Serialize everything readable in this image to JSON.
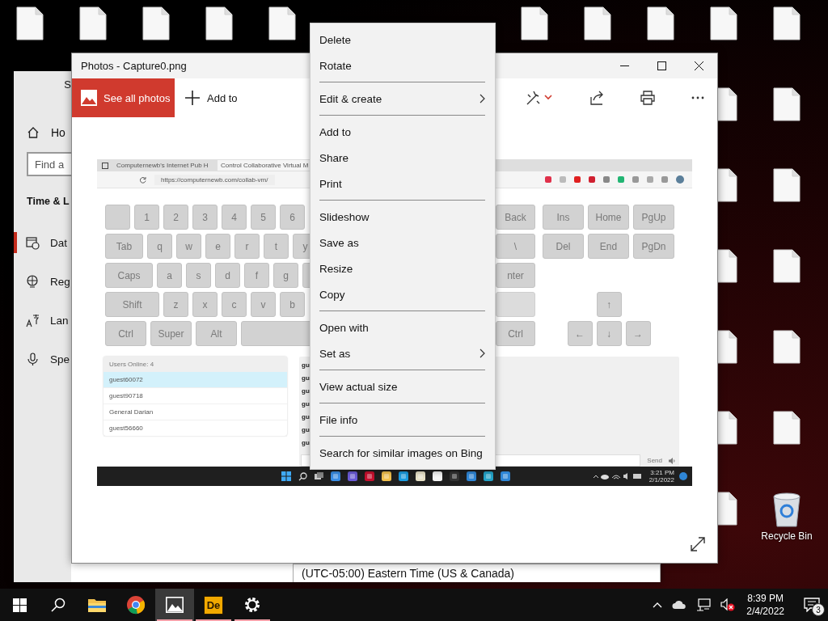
{
  "desktop": {
    "icons": [
      {
        "kind": "file"
      },
      {
        "kind": "file"
      },
      {
        "kind": "file"
      },
      {
        "kind": "file"
      },
      {
        "kind": "file"
      },
      {
        "kind": "file"
      },
      {
        "kind": "file"
      },
      {
        "kind": "file"
      },
      {
        "kind": "file"
      },
      {
        "kind": "file"
      },
      {
        "kind": "file"
      },
      {
        "kind": "file"
      },
      {
        "kind": "file"
      },
      {
        "kind": "file"
      },
      {
        "kind": "file"
      },
      {
        "kind": "file"
      },
      {
        "kind": "file"
      },
      {
        "kind": "file"
      },
      {
        "kind": "file"
      },
      {
        "kind": "file"
      },
      {
        "kind": "file"
      },
      {
        "kind": "recycle-bin",
        "label": "Recycle Bin"
      }
    ]
  },
  "settings_window": {
    "title": "S",
    "home": "Ho",
    "search": {
      "placeholder": "Find a"
    },
    "section": "Time & L",
    "nav": [
      {
        "label": "Dat",
        "kind": "calendar",
        "selected": true
      },
      {
        "label": "Reg",
        "kind": "globe",
        "selected": false
      },
      {
        "label": "Lan",
        "kind": "language",
        "selected": false
      },
      {
        "label": "Spe",
        "kind": "mic",
        "selected": false
      }
    ],
    "timezone": "(UTC-05:00) Eastern Time (US & Canada)"
  },
  "photos_window": {
    "title": "Photos - Capture0.png",
    "see_all": "See all photos",
    "add_to": "Add to"
  },
  "capture": {
    "tabs": [
      {
        "label": "Computernewb's Internet Pub H",
        "selected": false
      },
      {
        "label": "Control Collaborative Virtual M",
        "selected": true
      }
    ],
    "url": "https://computernewb.com/collab-vm/",
    "keys_left": [
      [
        {
          "kind": "blank"
        },
        {
          "kind": "char",
          "label": "1"
        },
        {
          "kind": "char",
          "label": "2"
        },
        {
          "kind": "char",
          "label": "3"
        },
        {
          "kind": "char",
          "label": "4"
        },
        {
          "kind": "char",
          "label": "5"
        },
        {
          "kind": "char",
          "label": "6"
        }
      ],
      [
        {
          "kind": "tab",
          "label": "Tab"
        },
        {
          "kind": "char",
          "label": "q"
        },
        {
          "kind": "char",
          "label": "w"
        },
        {
          "kind": "char",
          "label": "e"
        },
        {
          "kind": "char",
          "label": "r"
        },
        {
          "kind": "char",
          "label": "t"
        },
        {
          "kind": "char",
          "label": "y"
        }
      ],
      [
        {
          "kind": "caps",
          "label": "Caps"
        },
        {
          "kind": "char",
          "label": "a"
        },
        {
          "kind": "char",
          "label": "s"
        },
        {
          "kind": "char",
          "label": "d"
        },
        {
          "kind": "char",
          "label": "f"
        },
        {
          "kind": "char",
          "label": "g"
        },
        {
          "kind": "blank"
        }
      ],
      [
        {
          "kind": "shift",
          "label": "Shift"
        },
        {
          "kind": "char",
          "label": "z"
        },
        {
          "kind": "char",
          "label": "x"
        },
        {
          "kind": "char",
          "label": "c"
        },
        {
          "kind": "char",
          "label": "v"
        },
        {
          "kind": "char",
          "label": "b"
        }
      ],
      [
        {
          "kind": "mod",
          "label": "Ctrl"
        },
        {
          "kind": "mod",
          "label": "Super"
        },
        {
          "kind": "mod",
          "label": "Alt"
        },
        {
          "kind": "space"
        }
      ]
    ],
    "keys_main": [
      {
        "label": "Back"
      },
      {
        "label": "\\"
      },
      {
        "label": "nter"
      },
      {
        "kind": "blank"
      },
      {
        "label": "Ctrl"
      }
    ],
    "keys_nav": [
      [
        {
          "label": "Ins"
        },
        {
          "label": "Home"
        },
        {
          "label": "PgUp"
        }
      ],
      [
        {
          "label": "Del"
        },
        {
          "label": "End"
        },
        {
          "label": "PgDn"
        }
      ]
    ],
    "keys_arrows": [
      [
        {
          "label": "↑"
        }
      ],
      [
        {
          "label": "←"
        },
        {
          "label": "↓"
        },
        {
          "label": "→"
        }
      ]
    ],
    "users": {
      "header": "Users Online: 4",
      "list": [
        {
          "name": "guest60072",
          "selected": true
        },
        {
          "name": "guest90718",
          "selected": false
        },
        {
          "name": "General Darian",
          "selected": false
        },
        {
          "name": "guest56660",
          "selected": false
        }
      ]
    },
    "chat": {
      "lines": [
        "gu",
        "gu",
        "gu",
        "gu",
        "gu",
        "gu",
        "gu"
      ],
      "send": "Send"
    },
    "clock": {
      "time": "3:21 PM",
      "date": "2/1/2022"
    }
  },
  "context_menu": {
    "groups": [
      [
        {
          "label": "Delete",
          "submenu": false
        },
        {
          "label": "Rotate",
          "submenu": false
        }
      ],
      [
        {
          "label": "Edit & create",
          "submenu": true
        }
      ],
      [
        {
          "label": "Add to",
          "submenu": false
        },
        {
          "label": "Share",
          "submenu": false
        },
        {
          "label": "Print",
          "submenu": false
        }
      ],
      [
        {
          "label": "Slideshow",
          "submenu": false
        },
        {
          "label": "Save as",
          "submenu": false
        },
        {
          "label": "Resize",
          "submenu": false
        },
        {
          "label": "Copy",
          "submenu": false
        }
      ],
      [
        {
          "label": "Open with",
          "submenu": false
        },
        {
          "label": "Set as",
          "submenu": true
        }
      ],
      [
        {
          "label": "View actual size",
          "submenu": false
        }
      ],
      [
        {
          "label": "File info",
          "submenu": false
        }
      ],
      [
        {
          "label": "Search for similar images on Bing",
          "submenu": false
        }
      ]
    ]
  },
  "taskbar": {
    "apps": [
      {
        "kind": "explorer",
        "running": false,
        "active": false
      },
      {
        "kind": "chrome",
        "running": false,
        "active": false
      },
      {
        "kind": "photos",
        "running": true,
        "active": true
      },
      {
        "kind": "lettered",
        "label": "De",
        "running": true,
        "active": false
      },
      {
        "kind": "settings",
        "running": true,
        "active": false
      }
    ],
    "volume_muted": true,
    "time": "8:39 PM",
    "date": "2/4/2022",
    "notifications": "3"
  }
}
